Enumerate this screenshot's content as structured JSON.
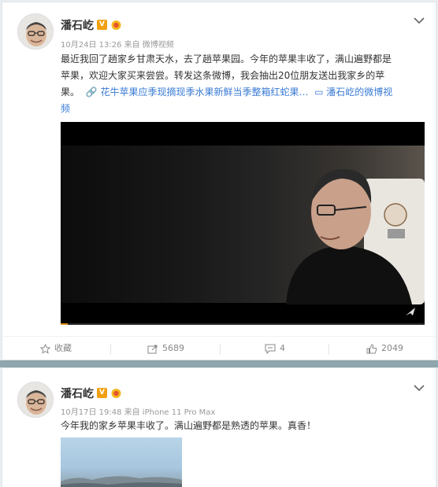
{
  "posts": [
    {
      "author": "潘石屹",
      "verified_badge": "V",
      "meta": "10月24日 13:26 来自 微博视频",
      "text_lines": [
        "最近我回了趟家乡甘肃天水，去了趟苹果园。今年的苹果丰收了，满山遍野都是",
        "苹果，欢迎大家买来尝尝。转发这条微博，我会抽出20位朋友送出我家乡的苹",
        "果。"
      ],
      "link_text": "花牛苹果应季现摘现季水果新鲜当季整箱红蛇果…",
      "video_link_line1": "潘石屹的微博视",
      "video_link_line2": "频",
      "video_progress": 0.02,
      "actions": {
        "favorite": "收藏",
        "repost": "5689",
        "comment": "4",
        "like": "2049"
      }
    },
    {
      "author": "潘石屹",
      "verified_badge": "V",
      "meta": "10月17日 19:48 来自 iPhone 11 Pro Max",
      "text": "今年我的家乡苹果丰收了。满山遍野都是熟透的苹果。真香！"
    }
  ],
  "colors": {
    "link": "#3a7bd5",
    "badge": "#f0a010",
    "divider": "#8ea6ad"
  },
  "icons": [
    "chevron-down-icon",
    "star-icon",
    "repost-icon",
    "comment-icon",
    "like-icon",
    "video-play-icon",
    "link-icon",
    "video-link-icon"
  ]
}
